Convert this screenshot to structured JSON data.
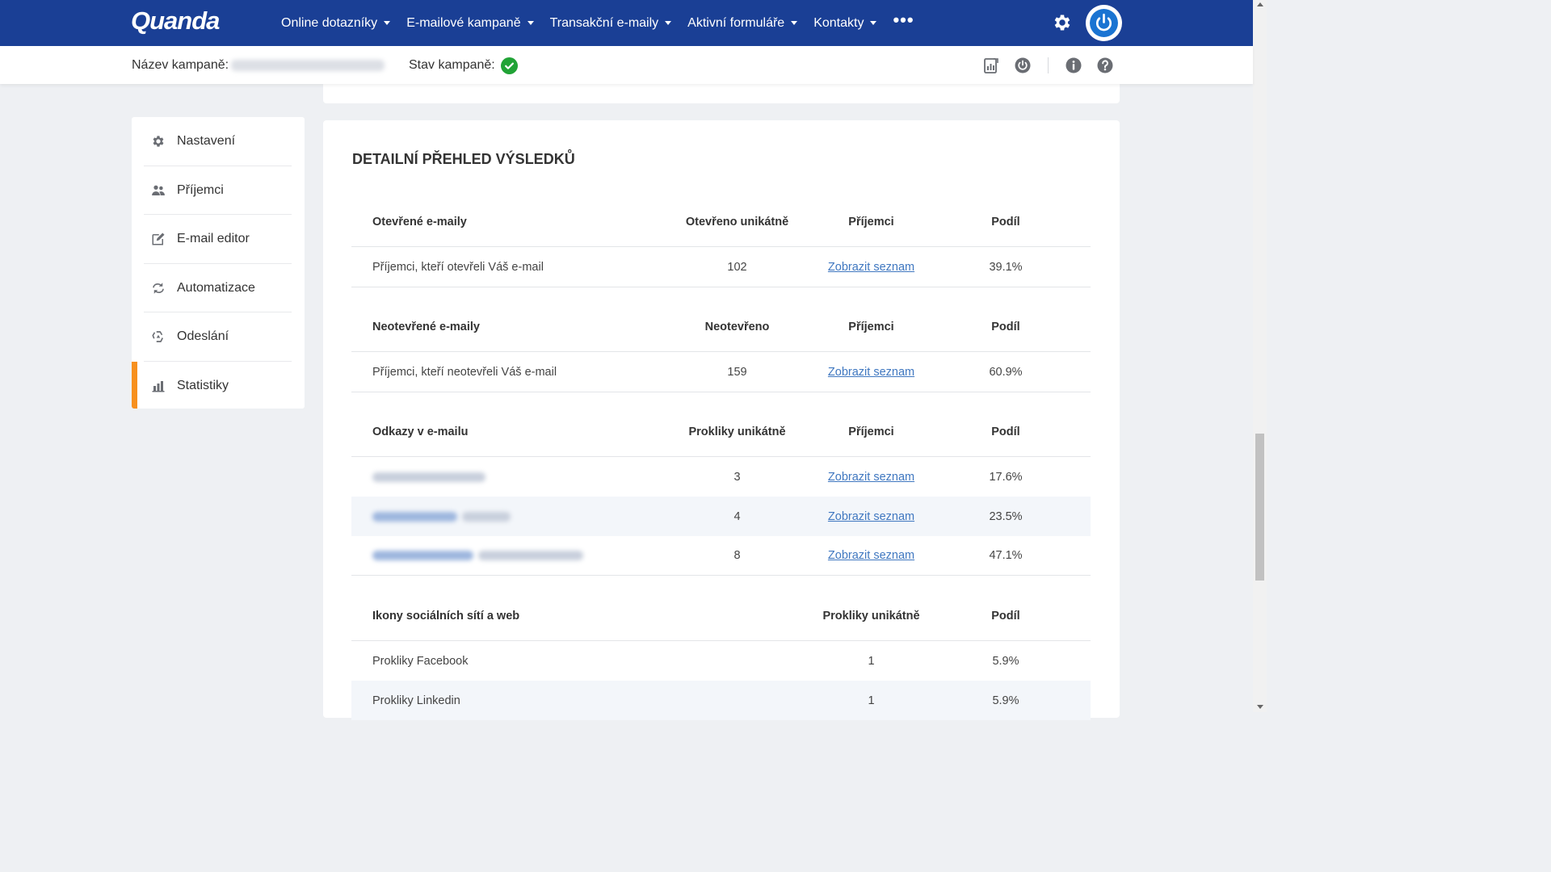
{
  "app": {
    "logo_text": "Quanda",
    "brand_color": "#1a3f95",
    "accent_color": "#f7901e",
    "success_color": "#21a336",
    "link_color": "#3f77c0"
  },
  "nav": {
    "items": [
      {
        "label": "Online dotazníky"
      },
      {
        "label": "E-mailové kampaně"
      },
      {
        "label": "Transakční e-maily"
      },
      {
        "label": "Aktivní formuláře"
      },
      {
        "label": "Kontakty"
      }
    ],
    "more_label": "•••"
  },
  "campaign": {
    "name_label": "Název kampaně:",
    "status_label": "Stav kampaně:"
  },
  "sidebar": {
    "items": [
      {
        "label": "Nastavení",
        "icon": "gear-icon"
      },
      {
        "label": "Příjemci",
        "icon": "users-icon"
      },
      {
        "label": "E-mail editor",
        "icon": "edit-icon"
      },
      {
        "label": "Automatizace",
        "icon": "refresh-icon"
      },
      {
        "label": "Odeslání",
        "icon": "recycle-icon"
      },
      {
        "label": "Statistiky",
        "icon": "bar-chart-icon",
        "active": true
      }
    ]
  },
  "results": {
    "title": "DETAILNÍ PŘEHLED VÝSLEDKŮ",
    "opened": {
      "headers": [
        "Otevřené e-maily",
        "Otevřeno unikátně",
        "Příjemci",
        "Podíl"
      ],
      "rows": [
        {
          "label": "Příjemci, kteří otevřeli Váš e-mail",
          "count": "102",
          "link": "Zobrazit seznam",
          "share": "39.1%"
        }
      ]
    },
    "unopened": {
      "headers": [
        "Neotevřené e-maily",
        "Neotevřeno",
        "Příjemci",
        "Podíl"
      ],
      "rows": [
        {
          "label": "Příjemci, kteří neotevřeli Váš e-mail",
          "count": "159",
          "link": "Zobrazit seznam",
          "share": "60.9%"
        }
      ]
    },
    "links": {
      "headers": [
        "Odkazy v e-mailu",
        "Prokliky unikátně",
        "Příjemci",
        "Podíl"
      ],
      "rows": [
        {
          "count": "3",
          "link": "Zobrazit seznam",
          "share": "17.6%"
        },
        {
          "count": "4",
          "link": "Zobrazit seznam",
          "share": "23.5%"
        },
        {
          "count": "8",
          "link": "Zobrazit seznam",
          "share": "47.1%"
        }
      ]
    },
    "social": {
      "headers": [
        "Ikony sociálních sítí a web",
        "Prokliky unikátně",
        "Podíl"
      ],
      "rows": [
        {
          "label": "Prokliky Facebook",
          "count": "1",
          "share": "5.9%"
        },
        {
          "label": "Prokliky Linkedin",
          "count": "1",
          "share": "5.9%"
        }
      ]
    }
  }
}
